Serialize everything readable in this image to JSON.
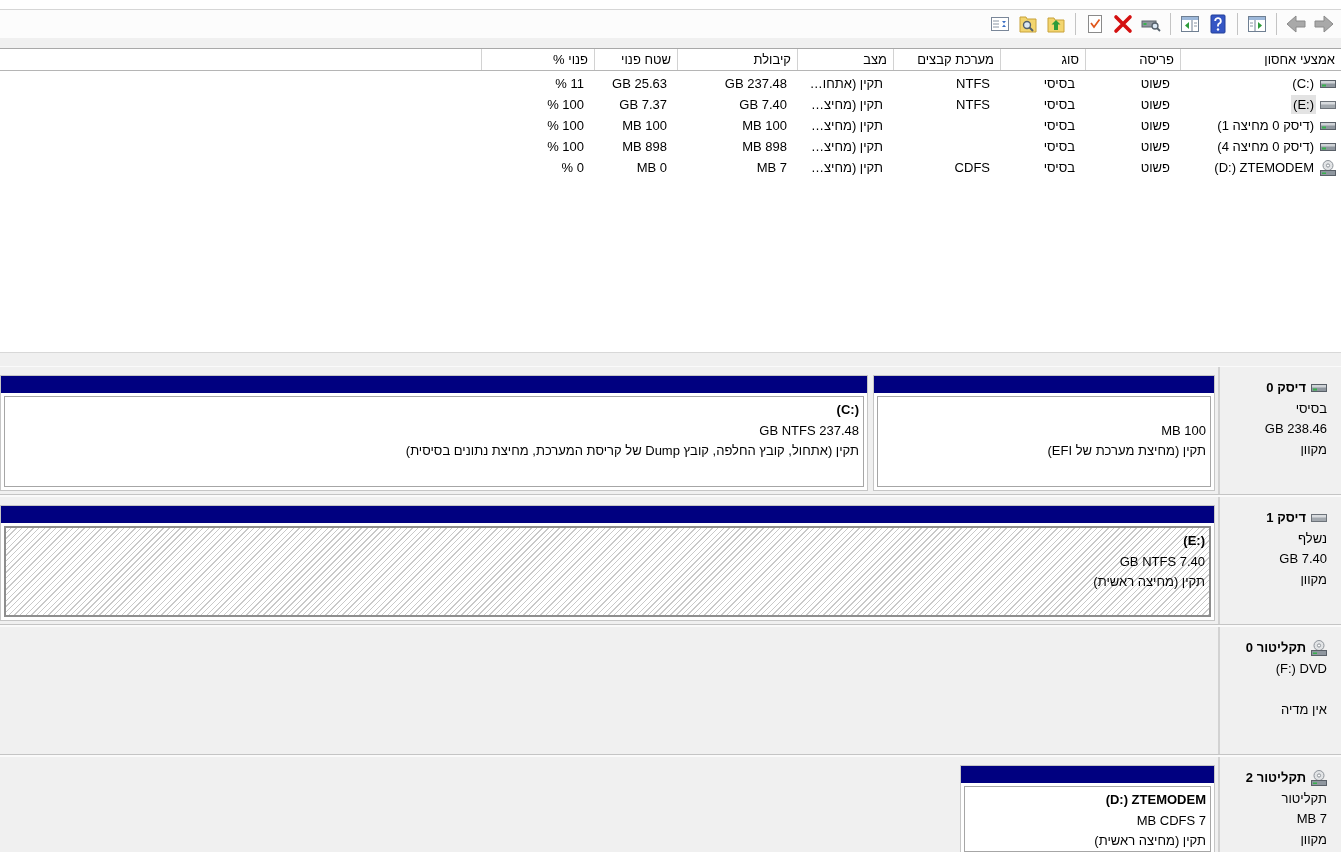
{
  "toolbar": {
    "groups": [
      [
        {
          "kind": "arrow-right",
          "disabled": true
        },
        {
          "kind": "arrow-left",
          "disabled": true
        }
      ],
      [
        {
          "kind": "tree-pane",
          "disabled": false
        }
      ],
      [
        {
          "kind": "help",
          "disabled": false
        },
        {
          "kind": "action-pane",
          "disabled": false
        }
      ],
      [
        {
          "kind": "drive-search",
          "disabled": false
        },
        {
          "kind": "cross",
          "disabled": false
        },
        {
          "kind": "doc-check",
          "disabled": false
        }
      ],
      [
        {
          "kind": "folder-up",
          "disabled": false
        },
        {
          "kind": "folder-search",
          "disabled": false
        },
        {
          "kind": "window-list",
          "disabled": false
        }
      ]
    ]
  },
  "volume_table": {
    "columns": [
      "אמצעי אחסון",
      "פריסה",
      "סוג",
      "מערכת קבצים",
      "מצב",
      "קיבולת",
      "שטח פנוי",
      "פנוי %"
    ],
    "rows": [
      {
        "kind": "disk",
        "selected": false,
        "volume": "(C:)",
        "layout": "פשוט",
        "type": "בסיסי",
        "file_system": "NTFS",
        "status": "תקין (אתחו…",
        "capacity": "GB 237.48",
        "free_space": "GB 25.63",
        "percent_free": "% 11"
      },
      {
        "kind": "removable",
        "selected": true,
        "volume": "(E:)",
        "layout": "פשוט",
        "type": "בסיסי",
        "file_system": "NTFS",
        "status": "תקין (מחיצ…",
        "capacity": "GB 7.40",
        "free_space": "GB 7.37",
        "percent_free": "% 100"
      },
      {
        "kind": "disk",
        "selected": false,
        "volume": "(דיסק 0 מחיצה 1)",
        "layout": "פשוט",
        "type": "בסיסי",
        "status": "תקין (מחיצ…",
        "capacity": "MB 100",
        "free_space": "MB 100",
        "percent_free": "% 100"
      },
      {
        "kind": "disk",
        "selected": false,
        "volume": "(דיסק 0 מחיצה 4)",
        "layout": "פשוט",
        "type": "בסיסי",
        "status": "תקין (מחיצ…",
        "capacity": "MB 898",
        "free_space": "MB 898",
        "percent_free": "% 100"
      },
      {
        "kind": "cd",
        "selected": false,
        "volume": "(D:) ZTEMODEM",
        "layout": "פשוט",
        "type": "בסיסי",
        "file_system": "CDFS",
        "status": "תקין (מחיצ…",
        "capacity": "MB 7",
        "free_space": "MB 0",
        "percent_free": "% 0"
      }
    ]
  },
  "disks": [
    {
      "kind": "disk",
      "title": "דיסק 0",
      "type": "בסיסי",
      "size": "GB 238.46",
      "status": "מקוון",
      "partitions": [
        {
          "selected": false,
          "size_fs": "MB 100",
          "status": "תקין (מחיצת מערכת של EFI)"
        },
        {
          "selected": false,
          "name": "(C:)",
          "size_fs": "GB NTFS 237.48",
          "status": "תקין (אתחול, קובץ החלפה, קובץ Dump של קריסת המערכת, מחיצת נתונים בסיסית)"
        }
      ]
    },
    {
      "kind": "removable",
      "title": "דיסק 1",
      "type": "נשלף",
      "size": "GB 7.40",
      "status": "מקוון",
      "partitions": [
        {
          "selected": true,
          "name": "(E:)",
          "size_fs": "GB NTFS 7.40",
          "status": "תקין (מחיצה ראשית)"
        }
      ]
    },
    {
      "kind": "cd",
      "title": "תקליטור 0",
      "type": "(F:) DVD",
      "status": "אין מדיה"
    },
    {
      "kind": "cd",
      "title": "תקליטור 2",
      "type": "תקליטור",
      "size": "MB 7",
      "status": "מקוון",
      "partitions": [
        {
          "selected": false,
          "name": "(D:) ZTEMODEM",
          "size_fs": "MB CDFS 7",
          "status": "תקין (מחיצה ראשית)"
        }
      ]
    }
  ]
}
